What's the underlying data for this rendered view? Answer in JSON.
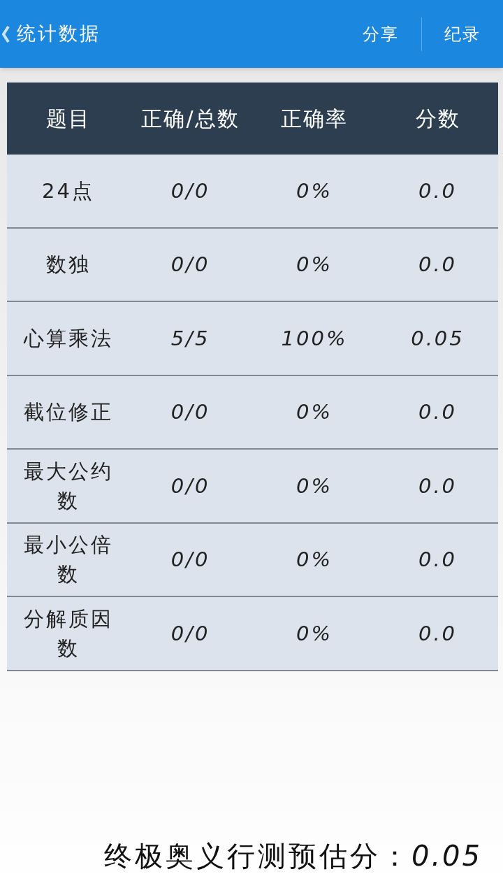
{
  "header": {
    "title": "统计数据",
    "actions": [
      "分享",
      "纪录"
    ]
  },
  "table": {
    "columns": [
      "题目",
      "正确/总数",
      "正确率",
      "分数"
    ],
    "rows": [
      [
        "24点",
        "0/0",
        "0%",
        "0.0"
      ],
      [
        "数独",
        "0/0",
        "0%",
        "0.0"
      ],
      [
        "心算乘法",
        "5/5",
        "100%",
        "0.05"
      ],
      [
        "截位修正",
        "0/0",
        "0%",
        "0.0"
      ],
      [
        "最大公约数",
        "0/0",
        "0%",
        "0.0"
      ],
      [
        "最小公倍数",
        "0/0",
        "0%",
        "0.0"
      ],
      [
        "分解质因数",
        "0/0",
        "0%",
        "0.0"
      ]
    ]
  },
  "footer": {
    "label": "终极奥义行测预估分：",
    "value": "0.05"
  }
}
